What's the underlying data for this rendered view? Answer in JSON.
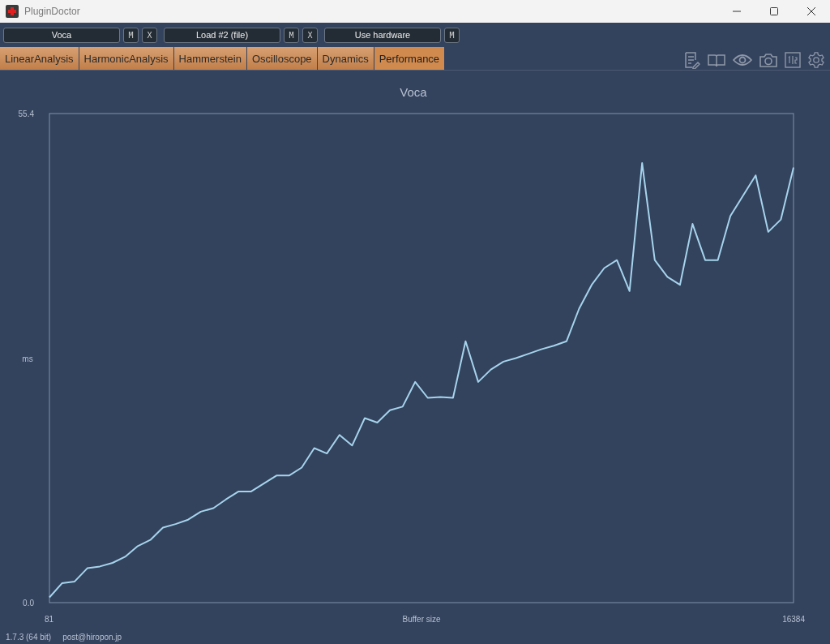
{
  "window": {
    "title": "PluginDoctor"
  },
  "toolbar": {
    "slots": [
      {
        "label": "Voca",
        "buttons": [
          "M",
          "X"
        ]
      },
      {
        "label": "Load #2 (file)",
        "buttons": [
          "M",
          "X"
        ]
      },
      {
        "label": "Use hardware",
        "buttons": [
          "M"
        ]
      }
    ]
  },
  "tabs": [
    {
      "label": "LinearAnalysis",
      "selected": false
    },
    {
      "label": "HarmonicAnalysis",
      "selected": false
    },
    {
      "label": "Hammerstein",
      "selected": false
    },
    {
      "label": "Oscilloscope",
      "selected": false
    },
    {
      "label": "Dynamics",
      "selected": false
    },
    {
      "label": "Performance",
      "selected": true
    }
  ],
  "chart_panel": {
    "chart_data": {
      "type": "line",
      "title": "Voca",
      "xlabel": "Buffer size",
      "ylabel": "ms",
      "x": [
        81,
        357,
        634,
        910,
        1186,
        1463,
        1739,
        2015,
        2292,
        2568,
        2844,
        3120,
        3397,
        3673,
        3949,
        4226,
        4502,
        4778,
        5055,
        5331,
        5607,
        5883,
        6160,
        6436,
        6712,
        6989,
        7265,
        7541,
        7818,
        8094,
        8370,
        8646,
        8923,
        9199,
        9475,
        9752,
        10028,
        10304,
        10581,
        10857,
        11133,
        11409,
        11686,
        11962,
        12238,
        12515,
        12791,
        13067,
        13344,
        13620,
        13896,
        14172,
        14449,
        14725,
        15001,
        15278,
        15554,
        15830,
        16107,
        16384
      ],
      "series": [
        {
          "color": "#a6d4ec",
          "values": [
            0.6,
            2.2,
            2.4,
            3.9,
            4.1,
            4.5,
            5.2,
            6.4,
            7.1,
            8.5,
            8.9,
            9.4,
            10.3,
            10.7,
            11.7,
            12.6,
            12.6,
            13.5,
            14.4,
            14.4,
            15.3,
            17.5,
            16.9,
            19.0,
            17.8,
            20.9,
            20.4,
            21.8,
            22.2,
            25.0,
            23.2,
            23.3,
            23.2,
            29.6,
            25.0,
            26.4,
            27.3,
            27.7,
            28.2,
            28.7,
            29.1,
            29.6,
            33.3,
            36.0,
            37.9,
            38.8,
            35.3,
            49.8,
            38.8,
            36.9,
            36.0,
            42.9,
            38.8,
            38.8,
            43.8,
            46.1,
            48.4,
            42.0,
            43.4,
            49.3
          ]
        }
      ],
      "xlim": [
        81,
        16384
      ],
      "ylim": [
        0,
        55.4
      ],
      "xticks": [
        81,
        16384
      ],
      "yticks": [
        {
          "value": 0,
          "label": "0.0"
        },
        {
          "value": 55.4,
          "label": "55.4"
        }
      ]
    }
  },
  "footer": {
    "version": "1.7.3 (64 bit)",
    "email": "post@hiropon.jp"
  }
}
